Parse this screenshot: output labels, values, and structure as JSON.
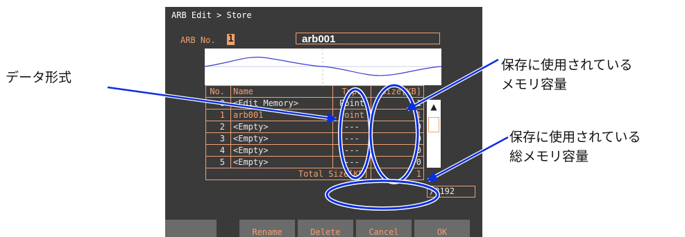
{
  "annotations": {
    "data_format": "データ形式",
    "used_memory_line1": "保存に使用されている",
    "used_memory_line2": "メモリ容量",
    "total_memory_line1": "保存に使用されている",
    "total_memory_line2": "総メモリ容量"
  },
  "screen": {
    "title": "ARB Edit > Store",
    "arb_no_label": "ARB No.",
    "arb_no_value": "1",
    "name_value": "arb001",
    "table": {
      "headers": [
        "No.",
        "Name",
        "Type",
        "Size[KB]"
      ],
      "rows": [
        {
          "no": "0",
          "name": "<Edit Memory>",
          "type": "Point",
          "size": "1"
        },
        {
          "no": "1",
          "name": "arb001",
          "type": "Point",
          "size": "1"
        },
        {
          "no": "2",
          "name": "<Empty>",
          "type": "---",
          "size": "0"
        },
        {
          "no": "3",
          "name": "<Empty>",
          "type": "---",
          "size": "0"
        },
        {
          "no": "4",
          "name": "<Empty>",
          "type": "---",
          "size": "0"
        },
        {
          "no": "5",
          "name": "<Empty>",
          "type": "---",
          "size": "0"
        }
      ],
      "total_label": "Total Size[KB]",
      "total_value": "1",
      "capacity": "/8192"
    },
    "scroll_up_icon": "triangle-up-icon",
    "softkeys": [
      "",
      "Rename",
      "Delete",
      "Cancel",
      "OK"
    ]
  },
  "colors": {
    "accent": "#f0a070",
    "screen_bg": "#3a3a3a",
    "callout": "#0a2fe0",
    "waveform": "#3a3ad0"
  }
}
